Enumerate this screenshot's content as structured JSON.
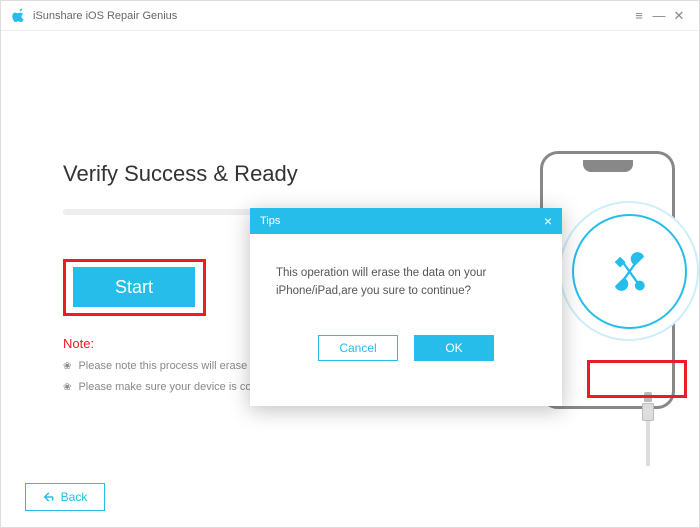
{
  "titlebar": {
    "title": "iSunshare iOS Repair Genius"
  },
  "main": {
    "heading": "Verify Success & Ready",
    "start_label": "Start",
    "note_label": "Note:",
    "note1": "Please note this process will erase the",
    "note2": "Please make sure your device is conne",
    "back_label": "Back"
  },
  "dialog": {
    "title": "Tips",
    "message": "This operation will erase the data on your iPhone/iPad,are you sure to continue?",
    "cancel_label": "Cancel",
    "ok_label": "OK"
  },
  "icons": {
    "bullet": "❀"
  }
}
